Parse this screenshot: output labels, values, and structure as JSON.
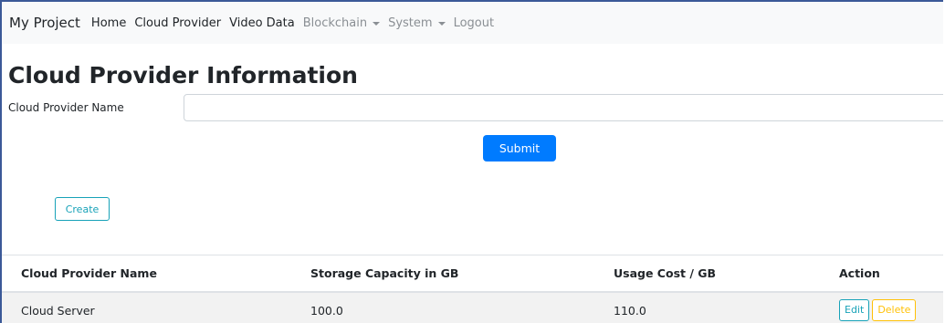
{
  "navbar": {
    "brand": "My Project",
    "items": [
      {
        "label": "Home",
        "dropdown": false,
        "muted": false
      },
      {
        "label": "Cloud Provider",
        "dropdown": false,
        "muted": false
      },
      {
        "label": "Video Data",
        "dropdown": false,
        "muted": false
      },
      {
        "label": "Blockchain",
        "dropdown": true,
        "muted": true
      },
      {
        "label": "System",
        "dropdown": true,
        "muted": true
      },
      {
        "label": "Logout",
        "dropdown": false,
        "muted": true
      }
    ]
  },
  "page": {
    "title": "Cloud Provider Information"
  },
  "form": {
    "name_label": "Cloud Provider Name",
    "name_value": "",
    "submit_label": "Submit"
  },
  "actions": {
    "create_label": "Create"
  },
  "table": {
    "headers": [
      "Cloud Provider Name",
      "Storage Capacity in GB",
      "Usage Cost / GB",
      "Action"
    ],
    "rows": [
      {
        "name": "Cloud Server",
        "storage": "100.0",
        "cost": "110.0",
        "edit_label": "Edit",
        "delete_label": "Delete"
      }
    ]
  },
  "colors": {
    "primary": "#007bff",
    "info": "#17a2b8",
    "warning": "#ffc107",
    "navbar_bg": "#f8f9fa",
    "row_bg": "#f2f2f2"
  }
}
